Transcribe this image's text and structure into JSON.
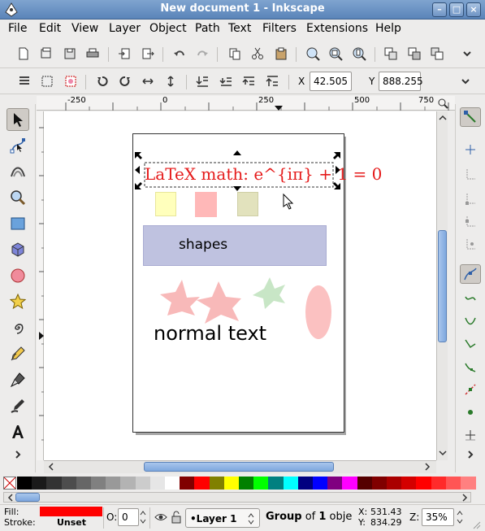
{
  "window": {
    "title": "New document 1 - Inkscape"
  },
  "menu": [
    "File",
    "Edit",
    "View",
    "Layer",
    "Object",
    "Path",
    "Text",
    "Filters",
    "Extensions",
    "Help"
  ],
  "toolbar": {
    "x_label": "X",
    "x_value": "42.505",
    "y_label": "Y",
    "y_value": "888.255"
  },
  "ruler": {
    "labels": [
      "-250",
      "0",
      "250",
      "500",
      "750"
    ]
  },
  "canvas": {
    "latex_text": "LaTeX math: e^{iπ} + 1 = 0",
    "latex_color": "#e51a1a",
    "shapes_label": "shapes",
    "normal_text": "normal text"
  },
  "palette": [
    "#000000",
    "#1a1a1a",
    "#333333",
    "#4d4d4d",
    "#666666",
    "#808080",
    "#999999",
    "#b3b3b3",
    "#cccccc",
    "#e6e6e6",
    "#ffffff",
    "#800000",
    "#ff0000",
    "#808000",
    "#ffff00",
    "#008000",
    "#00ff00",
    "#008080",
    "#00ffff",
    "#000080",
    "#0000ff",
    "#800080",
    "#ff00ff",
    "#550000",
    "#800000",
    "#aa0000",
    "#d40000",
    "#ff0000",
    "#ff2a2a",
    "#ff5555",
    "#ff8080"
  ],
  "status": {
    "fill_label": "Fill:",
    "stroke_label": "Stroke:",
    "fill_color": "#ff0000",
    "stroke_value": "Unset",
    "opacity_label": "O:",
    "opacity_value": "0",
    "layer": "•Layer 1",
    "sel_group": "Group",
    "sel_of": " of ",
    "sel_count": "1",
    "sel_rest": " obje",
    "x_label": "X:",
    "x_value": "531.43",
    "y_label": "Y:",
    "y_value": "834.29",
    "zoom_label": "Z:",
    "zoom_value": "35%"
  }
}
